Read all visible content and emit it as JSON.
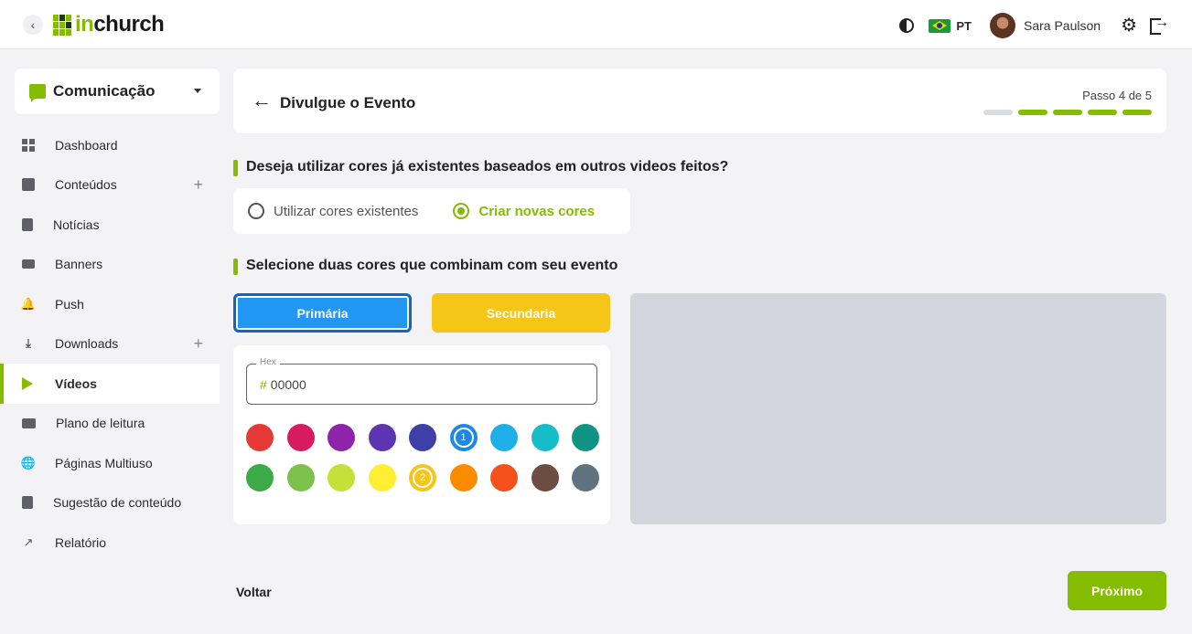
{
  "topbar": {
    "back_icon": "chevron-left-icon",
    "logo_prefix": "in",
    "logo_suffix": "church",
    "language": "PT",
    "user_name": "Sara Paulson",
    "icons": [
      "contrast-icon",
      "brazil-flag-icon",
      "settings-icon",
      "logout-icon"
    ]
  },
  "sidebar": {
    "module": "Comunicação",
    "items": [
      {
        "label": "Dashboard",
        "icon": "dashboard-icon"
      },
      {
        "label": "Conteúdos",
        "icon": "content-icon",
        "plus": "+"
      },
      {
        "label": "Notícias",
        "icon": "news-icon"
      },
      {
        "label": "Banners",
        "icon": "banner-icon"
      },
      {
        "label": "Push",
        "icon": "bell-icon"
      },
      {
        "label": "Downloads",
        "icon": "download-icon",
        "plus": "+"
      },
      {
        "label": "Vídeos",
        "icon": "play-icon",
        "active": true
      },
      {
        "label": "Plano de leitura",
        "icon": "reading-plan-icon"
      },
      {
        "label": "Páginas Multiuso",
        "icon": "globe-icon"
      },
      {
        "label": "Sugestão de conteúdo",
        "icon": "suggestion-icon"
      },
      {
        "label": "Relatório",
        "icon": "report-icon"
      }
    ]
  },
  "header": {
    "title": "Divulgue o Evento",
    "step_text": "Passo 4 de 5",
    "steps_total": 5,
    "steps_done": 4
  },
  "question1": {
    "title": "Deseja utilizar cores já existentes baseados em outros videos feitos?",
    "option_existing": "Utilizar cores existentes",
    "option_new": "Criar novas cores",
    "selected": "new"
  },
  "question2": {
    "title": "Selecione duas cores que combinam com seu evento"
  },
  "color_tabs": {
    "primary": "Primária",
    "secondary": "Secundaria",
    "primary_color": "#2196f3",
    "secondary_color": "#f5c518"
  },
  "picker": {
    "hex_label": "Hex",
    "hex_prefix": "#",
    "hex_value": "00000",
    "swatches": [
      {
        "color": "#e53935"
      },
      {
        "color": "#d81b60"
      },
      {
        "color": "#8e24aa"
      },
      {
        "color": "#5e35b1"
      },
      {
        "color": "#3f3fa8"
      },
      {
        "color": "#1e88e5",
        "badge": "1"
      },
      {
        "color": "#1eaee8"
      },
      {
        "color": "#16bcc8"
      },
      {
        "color": "#0f9484"
      },
      {
        "color": "#3daa48"
      },
      {
        "color": "#7cc24a"
      },
      {
        "color": "#c6e03a"
      },
      {
        "color": "#ffee33"
      },
      {
        "color": "#f5c518",
        "badge": "2"
      },
      {
        "color": "#fb8c00"
      },
      {
        "color": "#f4511e"
      },
      {
        "color": "#6d4c41"
      },
      {
        "color": "#5f7280"
      }
    ]
  },
  "footer": {
    "back_label": "Voltar",
    "next_label": "Próximo"
  },
  "colors": {
    "accent": "#84bd00"
  }
}
